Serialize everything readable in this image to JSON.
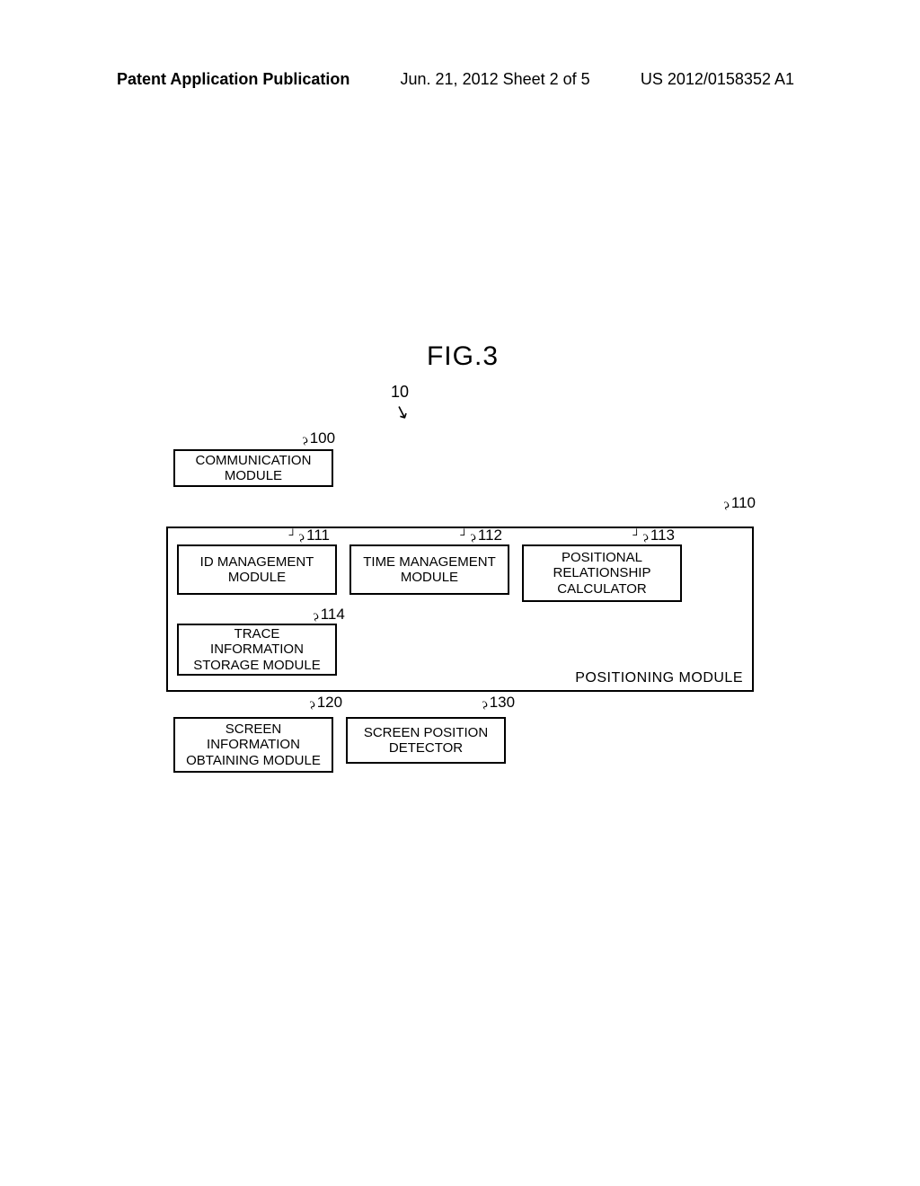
{
  "header": {
    "left": "Patent Application Publication",
    "center": "Jun. 21, 2012  Sheet 2 of 5",
    "right": "US 2012/0158352 A1"
  },
  "figure": {
    "label": "FIG.3",
    "ref10": "10",
    "ref100": "100",
    "comm_module": "COMMUNICATION\nMODULE",
    "ref110": "110",
    "ref111": "111",
    "box111": "ID MANAGEMENT\nMODULE",
    "ref112": "112",
    "box112": "TIME MANAGEMENT\nMODULE",
    "ref113": "113",
    "box113": "POSITIONAL\nRELATIONSHIP\nCALCULATOR",
    "ref114": "114",
    "box114": "TRACE\nINFORMATION\nSTORAGE MODULE",
    "positioning_label": "POSITIONING MODULE",
    "ref120": "120",
    "box120": "SCREEN\nINFORMATION\nOBTAINING MODULE",
    "ref130": "130",
    "box130": "SCREEN POSITION\nDETECTOR"
  }
}
